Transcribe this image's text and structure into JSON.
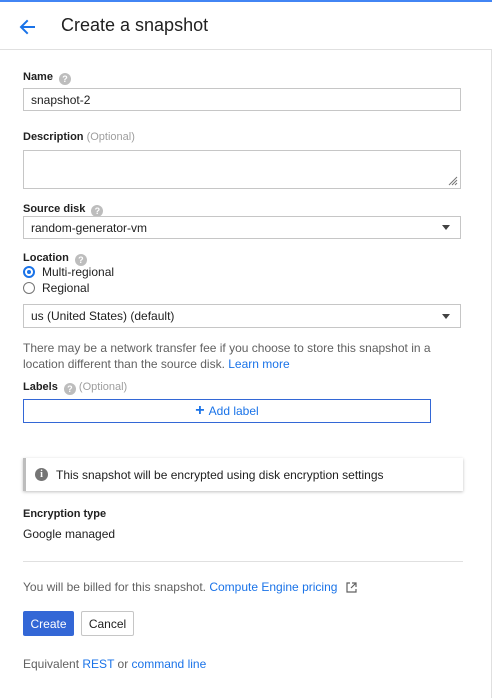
{
  "header": {
    "title": "Create a snapshot"
  },
  "name": {
    "label": "Name",
    "value": "snapshot-2"
  },
  "description": {
    "label": "Description",
    "optional": "(Optional)",
    "value": ""
  },
  "source_disk": {
    "label": "Source disk",
    "value": "random-generator-vm"
  },
  "location": {
    "label": "Location",
    "options": [
      {
        "label": "Multi-regional",
        "selected": true
      },
      {
        "label": "Regional",
        "selected": false
      }
    ],
    "region_value": "us (United States) (default)",
    "note": "There may be a network transfer fee if you choose to store this snapshot in a location different than the source disk.",
    "learn_more": "Learn more"
  },
  "labels": {
    "label": "Labels",
    "optional": "(Optional)",
    "add_label": "Add label"
  },
  "encryption_notice": "This snapshot will be encrypted using disk encryption settings",
  "encryption": {
    "label": "Encryption type",
    "value": "Google managed"
  },
  "billing": {
    "text": "You will be billed for this snapshot.",
    "link": "Compute Engine pricing"
  },
  "actions": {
    "create": "Create",
    "cancel": "Cancel"
  },
  "equivalent": {
    "prefix": "Equivalent",
    "rest": "REST",
    "or": "or",
    "command_line": "command line"
  },
  "colors": {
    "accent": "#1a73e8",
    "primary_button": "#3367d6",
    "top_stripe": "#4285f4"
  }
}
